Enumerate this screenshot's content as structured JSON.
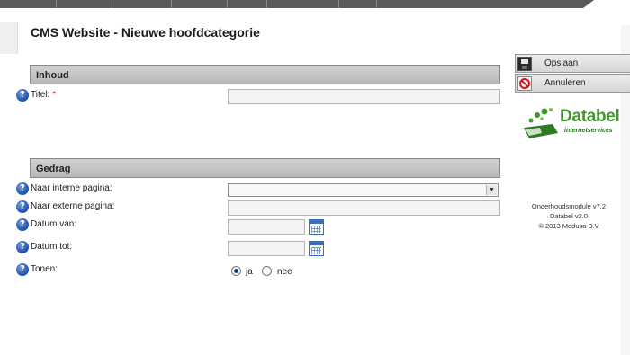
{
  "page": {
    "title": "CMS Website - Nieuwe hoofdcategorie"
  },
  "sections": {
    "inhoud": {
      "header": "Inhoud",
      "fields": {
        "titel": {
          "label": "Titel:",
          "required_mark": "*",
          "value": ""
        }
      }
    },
    "gedrag": {
      "header": "Gedrag",
      "fields": {
        "naar_interne_pagina": {
          "label": "Naar interne pagina:",
          "selected": ""
        },
        "naar_externe_pagina": {
          "label": "Naar externe pagina:",
          "value": ""
        },
        "datum_van": {
          "label": "Datum van:",
          "value": ""
        },
        "datum_tot": {
          "label": "Datum tot:",
          "value": ""
        },
        "tonen": {
          "label": "Tonen:",
          "options": [
            {
              "label": "ja",
              "checked": true
            },
            {
              "label": "nee",
              "checked": false
            }
          ]
        }
      }
    }
  },
  "actions": {
    "save_label": "Opslaan",
    "cancel_label": "Annuleren"
  },
  "logo": {
    "name": "Databel",
    "tagline": "internetservices"
  },
  "info": {
    "module_version": "Onderhoudsmodule v7.2",
    "app_version": "Databel v2.0",
    "copyright": "© 2013 Medusa B.V"
  },
  "icons": {
    "help": "help-icon",
    "calendar": "calendar-icon",
    "save": "floppy-disk-icon",
    "cancel": "cancel-circle-icon"
  },
  "colors": {
    "section_header_bg": "#c4c4c4",
    "required": "#c0392b",
    "logo_green": "#3f9a2a",
    "help_blue": "#1e4fae"
  }
}
